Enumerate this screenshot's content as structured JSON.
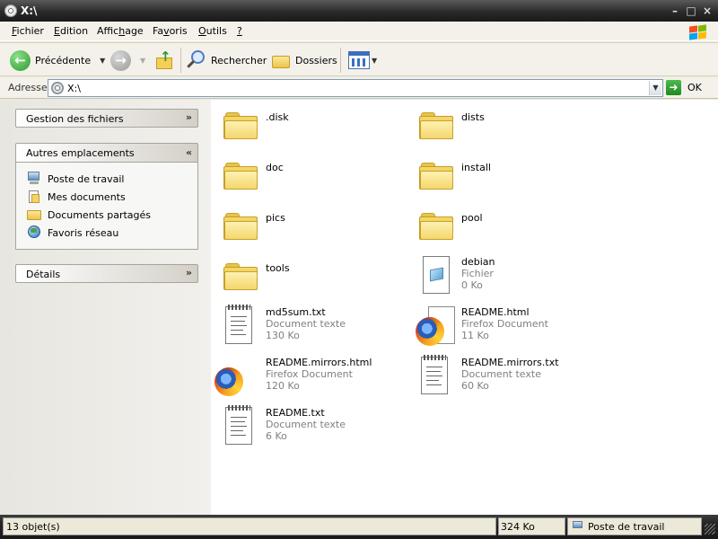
{
  "window": {
    "title": "X:\\",
    "controls": {
      "minimize": "–",
      "maximize": "□",
      "close": "×"
    }
  },
  "menu": {
    "items": [
      {
        "label": "Fichier",
        "key": "F"
      },
      {
        "label": "Edition",
        "key": "E"
      },
      {
        "label": "Affichage",
        "key": "h"
      },
      {
        "label": "Favoris",
        "key": "v"
      },
      {
        "label": "Outils",
        "key": "O"
      },
      {
        "label": "?",
        "key": "?"
      }
    ]
  },
  "toolbar": {
    "back_label": "Précédente",
    "search_label": "Rechercher",
    "folders_label": "Dossiers"
  },
  "address": {
    "label": "Adresse",
    "value": "X:\\",
    "go_label": "OK"
  },
  "taskpane": {
    "file_tasks_title": "Gestion des fichiers",
    "other_places_title": "Autres emplacements",
    "other_places": [
      {
        "label": "Poste de travail",
        "icon": "computer-icon"
      },
      {
        "label": "Mes documents",
        "icon": "documents-icon"
      },
      {
        "label": "Documents partagés",
        "icon": "shared-folder-icon"
      },
      {
        "label": "Favoris réseau",
        "icon": "network-icon"
      }
    ],
    "details_title": "Détails"
  },
  "files": [
    {
      "name": ".disk",
      "kind": "folder"
    },
    {
      "name": "dists",
      "kind": "folder"
    },
    {
      "name": "doc",
      "kind": "folder"
    },
    {
      "name": "install",
      "kind": "folder"
    },
    {
      "name": "pics",
      "kind": "folder"
    },
    {
      "name": "pool",
      "kind": "folder"
    },
    {
      "name": "tools",
      "kind": "folder"
    },
    {
      "name": "debian",
      "kind": "file",
      "type": "Fichier",
      "size": "0 Ko"
    },
    {
      "name": "md5sum.txt",
      "kind": "text",
      "type": "Document texte",
      "size": "130 Ko"
    },
    {
      "name": "README.html",
      "kind": "firefox",
      "type": "Firefox Document",
      "size": "11 Ko"
    },
    {
      "name": "README.mirrors.html",
      "kind": "firefox",
      "type": "Firefox Document",
      "size": "120 Ko"
    },
    {
      "name": "README.mirrors.txt",
      "kind": "text",
      "type": "Document texte",
      "size": "60 Ko"
    },
    {
      "name": "README.txt",
      "kind": "text",
      "type": "Document texte",
      "size": "6 Ko"
    }
  ],
  "status": {
    "count": "13 objet(s)",
    "size": "324 Ko",
    "location": "Poste de travail"
  }
}
